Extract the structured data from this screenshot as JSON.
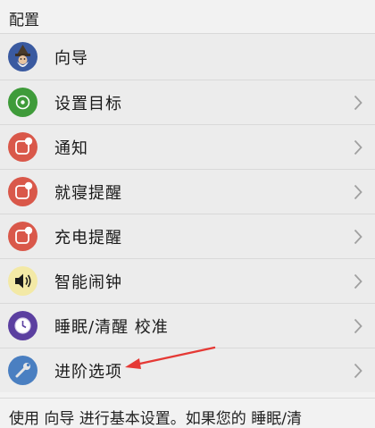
{
  "header": {
    "title": "配置"
  },
  "items": [
    {
      "label": "向导",
      "icon": "wizard-icon",
      "color": "#3a5aa0",
      "chevron": false
    },
    {
      "label": "设置目标",
      "icon": "target-icon",
      "color": "#3f9b3a",
      "chevron": true
    },
    {
      "label": "通知",
      "icon": "notification-icon",
      "color": "#d9584a",
      "chevron": true
    },
    {
      "label": "就寝提醒",
      "icon": "notification-icon",
      "color": "#d9584a",
      "chevron": true
    },
    {
      "label": "充电提醒",
      "icon": "notification-icon",
      "color": "#d9584a",
      "chevron": true
    },
    {
      "label": "智能闹钟",
      "icon": "speaker-icon",
      "color": "#f3e9a6",
      "chevron": true
    },
    {
      "label": "睡眠/清醒 校准",
      "icon": "clock-icon",
      "color": "#5b3fa0",
      "chevron": true
    },
    {
      "label": "进阶选项",
      "icon": "wrench-icon",
      "color": "#4a7fc1",
      "chevron": true
    }
  ],
  "footer": {
    "text": "使用 向导 进行基本设置。如果您的 睡眠/清"
  },
  "annotation": {
    "color": "#e53935"
  }
}
